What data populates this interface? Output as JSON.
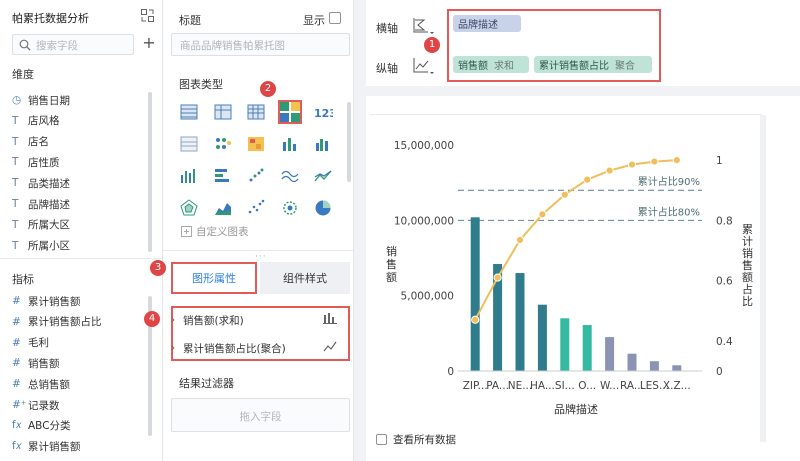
{
  "left_panel": {
    "title": "帕累托数据分析",
    "search_placeholder": "搜索字段",
    "dimension_header": "维度",
    "dimensions": [
      {
        "icon": "clock-icon",
        "glyph": "◷",
        "label": "销售日期"
      },
      {
        "icon": "text-icon",
        "glyph": "T",
        "label": "店风格"
      },
      {
        "icon": "text-icon",
        "glyph": "T",
        "label": "店名"
      },
      {
        "icon": "text-icon",
        "glyph": "T",
        "label": "店性质"
      },
      {
        "icon": "text-icon",
        "glyph": "T",
        "label": "品类描述"
      },
      {
        "icon": "text-icon",
        "glyph": "T",
        "label": "品牌描述"
      },
      {
        "icon": "text-icon",
        "glyph": "T",
        "label": "所属大区"
      },
      {
        "icon": "text-icon",
        "glyph": "T",
        "label": "所属小区"
      }
    ],
    "measure_header": "指标",
    "measures": [
      {
        "icon": "number-icon",
        "glyph": "#",
        "label": "累计销售额"
      },
      {
        "icon": "number-icon",
        "glyph": "#",
        "label": "累计销售额占比"
      },
      {
        "icon": "number-icon",
        "glyph": "#",
        "label": "毛利"
      },
      {
        "icon": "number-icon",
        "glyph": "#",
        "label": "销售额"
      },
      {
        "icon": "number-icon",
        "glyph": "#",
        "label": "总销售额"
      },
      {
        "icon": "record-icon",
        "glyph": "#⁺",
        "label": "记录数"
      },
      {
        "icon": "formula-icon",
        "glyph": "f𝑥",
        "label": "ABC分类"
      },
      {
        "icon": "formula-icon",
        "glyph": "f𝑥",
        "label": "累计销售额"
      }
    ]
  },
  "middle_panel": {
    "title_label": "标题",
    "show_label": "显示",
    "title_placeholder": "商品品牌销售帕累托图",
    "chart_type_label": "图表类型",
    "custom_chart_label": "自定义图表",
    "tab_graph_attr": "图形属性",
    "tab_component_style": "组件样式",
    "series": [
      {
        "label": "销售额(求和)",
        "icon": "bar-chart-icon"
      },
      {
        "label": "累计销售额占比(聚合)",
        "icon": "line-chart-icon"
      }
    ],
    "result_filter_label": "结果过滤器",
    "drop_placeholder": "拖入字段"
  },
  "axis_panel": {
    "x_label": "横轴",
    "y_label": "纵轴",
    "x_pill": "品牌描述",
    "y_pills": [
      {
        "name": "销售额",
        "agg": "求和"
      },
      {
        "name": "累计销售额占比",
        "agg": "聚合"
      }
    ]
  },
  "badges": [
    "1",
    "2",
    "3",
    "4"
  ],
  "show_all_label": "查看所有数据",
  "colors": {
    "accent": "#2f7fe0",
    "highlight_border": "#e25a5a",
    "badge": "#e04545",
    "line": "#f0be5a",
    "bar_dark": "#2e7c8c",
    "bar_teal": "#35b9a0",
    "bar_slate": "#8b93b5"
  },
  "chart_data": {
    "type": "bar",
    "xlabel": "品牌描述",
    "ylabel": "销售额",
    "y2label": "累计销售额占比",
    "categories": [
      "ZIP...",
      "PA...",
      "NE...",
      "HA...",
      "SI...",
      "O...",
      "W...",
      "RA...",
      "LES...",
      "X.Z..."
    ],
    "ylim": [
      0,
      15000000
    ],
    "yticks": [
      "0",
      "5,000,000",
      "10,000,000",
      "15,000,000"
    ],
    "y2lim": [
      0.3,
      1.05
    ],
    "y2ticks": [
      "0",
      "0.4",
      "0.6",
      "0.8",
      "1"
    ],
    "series": [
      {
        "name": "销售额",
        "kind": "bar",
        "values": [
          10200000,
          7100000,
          6500000,
          4400000,
          3500000,
          3050000,
          2250000,
          1150000,
          650000,
          380000
        ]
      },
      {
        "name": "累计占比",
        "kind": "line",
        "values": [
          0.47,
          0.61,
          0.735,
          0.82,
          0.885,
          0.935,
          0.965,
          0.985,
          0.995,
          1.0
        ]
      }
    ],
    "bar_colors": [
      "#2e7c8c",
      "#2e7c8c",
      "#2e7c8c",
      "#2e7c8c",
      "#35b9a0",
      "#35b9a0",
      "#8b93b5",
      "#8b93b5",
      "#8b93b5",
      "#8b93b5"
    ],
    "reference_lines": [
      {
        "label": "累计占比90%",
        "value": 0.9
      },
      {
        "label": "累计占比80%",
        "value": 0.8
      }
    ],
    "grid": false,
    "legend": "none"
  }
}
